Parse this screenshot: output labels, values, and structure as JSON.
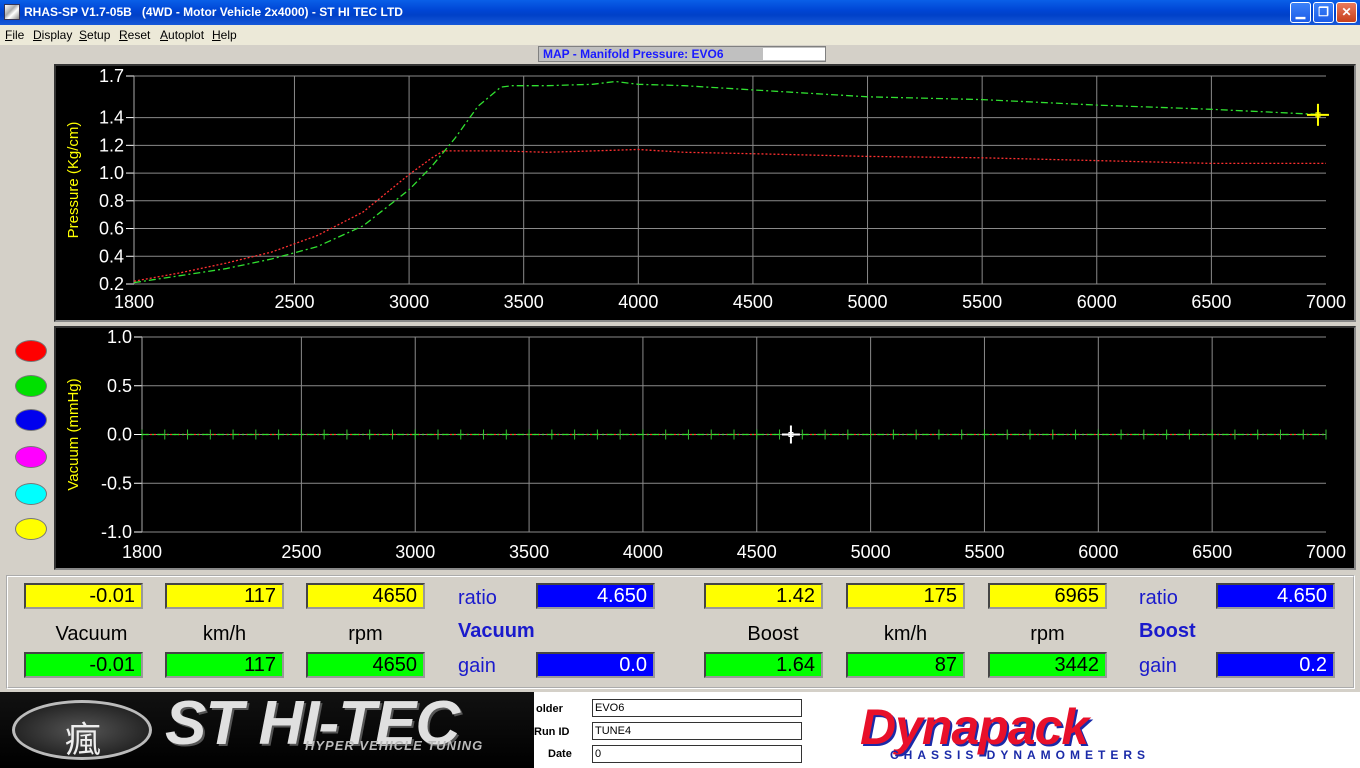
{
  "window": {
    "title": "RHAS-SP V1.7-05B   (4WD - Motor Vehicle 2x4000) - ST HI TEC LTD",
    "minimize": "▁",
    "maximize": "❐",
    "close": "✕"
  },
  "menu": [
    "File",
    "Display",
    "Setup",
    "Reset",
    "Autoplot",
    "Help"
  ],
  "chart_title": "MAP - Manifold Pressure: EVO6",
  "chart_data": [
    {
      "type": "line",
      "ylabel": "Pressure (Kg/cm)",
      "xlim": [
        1800,
        7000
      ],
      "ylim": [
        0.2,
        1.7
      ],
      "x_ticks": [
        "1800",
        "2500",
        "3000",
        "3500",
        "4000",
        "4500",
        "5000",
        "5500",
        "6000",
        "6500",
        "7000"
      ],
      "y_ticks": [
        "1.7",
        "1.4",
        "1.2",
        "1.0",
        "0.8",
        "0.6",
        "0.4",
        "0.2"
      ],
      "grid": true,
      "series": [
        {
          "color": "#ff3030",
          "x": [
            1800,
            2000,
            2200,
            2400,
            2600,
            2800,
            3000,
            3100,
            3150,
            3200,
            3400,
            3600,
            3800,
            4000,
            4200,
            4500,
            5000,
            5500,
            6000,
            6500,
            7000
          ],
          "y": [
            0.22,
            0.28,
            0.35,
            0.43,
            0.55,
            0.72,
            0.99,
            1.11,
            1.16,
            1.16,
            1.16,
            1.15,
            1.16,
            1.17,
            1.15,
            1.14,
            1.12,
            1.11,
            1.09,
            1.07,
            1.07
          ]
        },
        {
          "color": "#30e030",
          "x": [
            1800,
            2000,
            2200,
            2400,
            2600,
            2800,
            3000,
            3100,
            3200,
            3300,
            3400,
            3450,
            3600,
            3800,
            3900,
            4000,
            4200,
            4500,
            5000,
            5500,
            6000,
            6500,
            7000
          ],
          "y": [
            0.21,
            0.26,
            0.31,
            0.38,
            0.47,
            0.62,
            0.88,
            1.05,
            1.25,
            1.48,
            1.62,
            1.63,
            1.63,
            1.64,
            1.66,
            1.64,
            1.63,
            1.6,
            1.55,
            1.53,
            1.49,
            1.46,
            1.42
          ]
        }
      ],
      "cursor": {
        "x": 6965,
        "y": 1.42
      }
    },
    {
      "type": "line",
      "ylabel": "Vacuum (mmHg)",
      "xlim": [
        1800,
        7000
      ],
      "ylim": [
        -1.0,
        1.0
      ],
      "x_ticks": [
        "1800",
        "2500",
        "3000",
        "3500",
        "4000",
        "4500",
        "5000",
        "5500",
        "6000",
        "6500",
        "7000"
      ],
      "y_ticks": [
        "1.0",
        "0.5",
        "0.0",
        "-0.5",
        "-1.0"
      ],
      "grid": true,
      "series": [
        {
          "color": "#ff3030",
          "x": [
            1800,
            7000
          ],
          "y": [
            0.0,
            0.0
          ]
        },
        {
          "color": "#30e030",
          "x": [
            1800,
            7000
          ],
          "y": [
            0.0,
            0.0
          ]
        }
      ],
      "cursor": {
        "x": 4650,
        "y": 0.0
      }
    }
  ],
  "channels": [
    "#ff0000",
    "#00e000",
    "#0000ee",
    "#ff00ff",
    "#00ffff",
    "#ffff00"
  ],
  "readouts": {
    "vacuum": {
      "top": [
        "-0.01",
        "117",
        "4650"
      ],
      "bottom": [
        "-0.01",
        "117",
        "4650"
      ],
      "ratio_label": "ratio",
      "ratio": "4.650",
      "gain_label": "gain",
      "gain": "0.0",
      "title": "Vacuum",
      "labels": [
        "Vacuum",
        "km/h",
        "rpm"
      ]
    },
    "boost": {
      "top": [
        "1.42",
        "175",
        "6965"
      ],
      "bottom": [
        "1.64",
        "87",
        "3442"
      ],
      "ratio_label": "ratio",
      "ratio": "4.650",
      "gain_label": "gain",
      "gain": "0.2",
      "title": "Boost",
      "labels": [
        "Boost",
        "km/h",
        "rpm"
      ]
    }
  },
  "footer": {
    "st_logo_glyph": "瘋",
    "st_logo_text": "ST HI-TEC",
    "st_logo_sub": "HYPER VEHICLE TUNING",
    "folder_label": "older",
    "folder": "EVO6",
    "run_id_label": "Run ID",
    "run_id": "TUNE4",
    "date_label": "Date",
    "date": "0",
    "dyna_text": "Dynapack",
    "dyna_sub": "CHASSIS DYNAMOMETERS"
  }
}
